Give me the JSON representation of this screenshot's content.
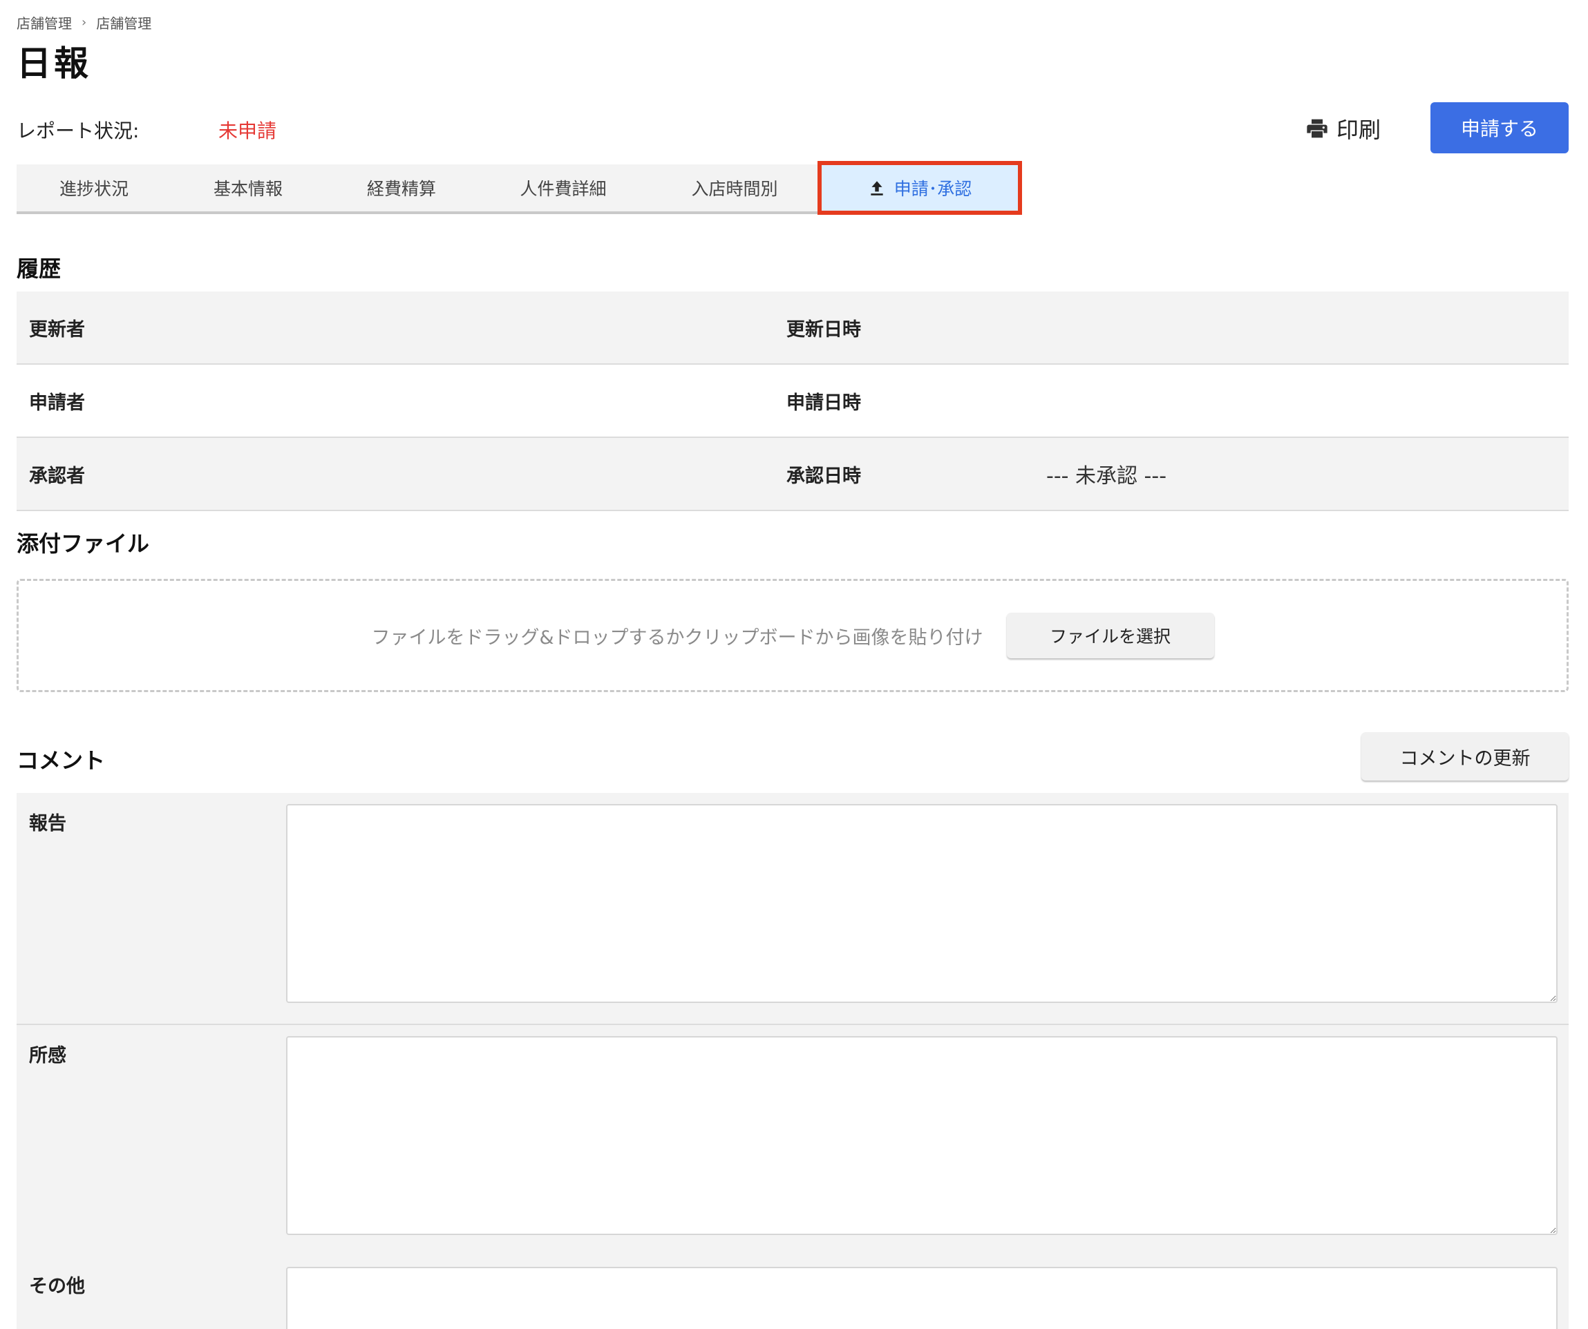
{
  "breadcrumb": {
    "items": [
      "店舗管理",
      "店舗管理"
    ],
    "separator": "›"
  },
  "page": {
    "title": "日報"
  },
  "status": {
    "label": "レポート状況:",
    "value": "未申請",
    "value_color": "#e53935"
  },
  "actions": {
    "print_label": "印刷",
    "print_icon": "printer-icon",
    "apply_label": "申請する",
    "apply_color": "#3b6ee4"
  },
  "tabs": [
    {
      "label": "進捗状況"
    },
    {
      "label": "基本情報"
    },
    {
      "label": "経費精算"
    },
    {
      "label": "人件費詳細"
    },
    {
      "label": "入店時間別"
    },
    {
      "label": "申請･承認",
      "icon": "upload-icon",
      "active": true
    }
  ],
  "history": {
    "title": "履歴",
    "rows": [
      {
        "who_label": "更新者",
        "when_label": "更新日時",
        "when_value": ""
      },
      {
        "who_label": "申請者",
        "when_label": "申請日時",
        "when_value": ""
      },
      {
        "who_label": "承認者",
        "when_label": "承認日時",
        "when_value": "--- 未承認 ---"
      }
    ]
  },
  "attachments": {
    "title": "添付ファイル",
    "drop_text": "ファイルをドラッグ&ドロップするかクリップボードから画像を貼り付け",
    "select_label": "ファイルを選択"
  },
  "comments": {
    "title": "コメント",
    "update_label": "コメントの更新",
    "fields": [
      {
        "label": "報告",
        "value": ""
      },
      {
        "label": "所感",
        "value": ""
      },
      {
        "label": "その他",
        "value": ""
      }
    ]
  }
}
